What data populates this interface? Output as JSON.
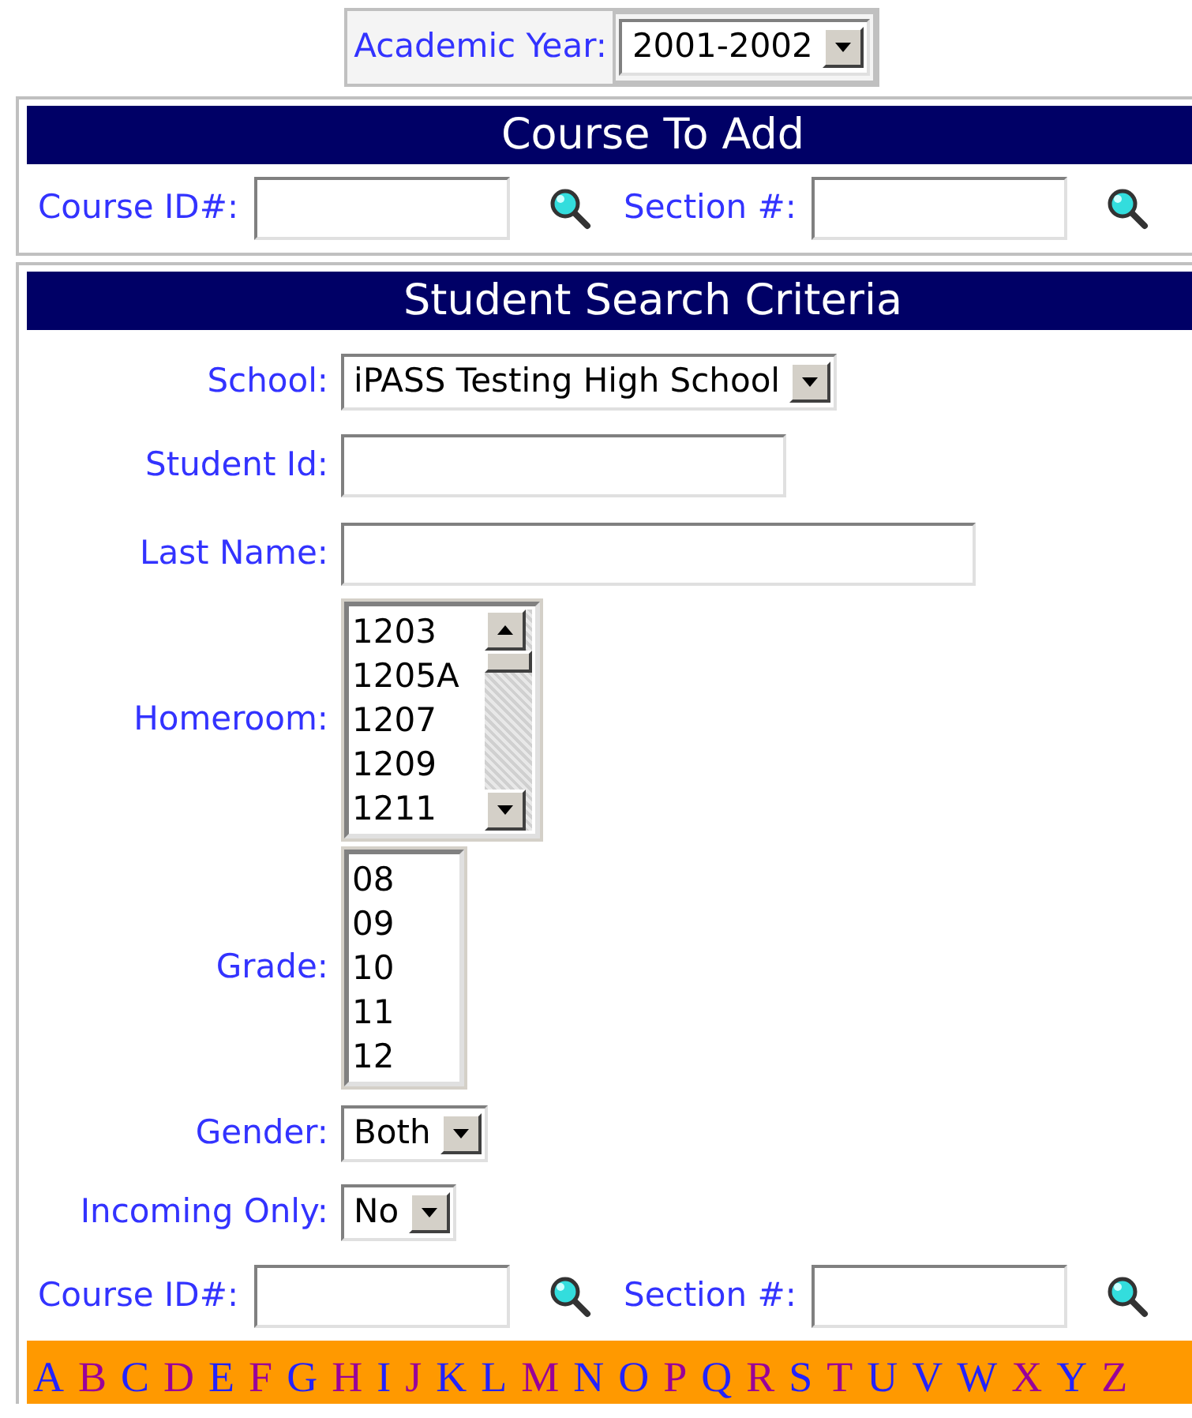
{
  "academic_year": {
    "label": "Academic Year:",
    "value": "2001-2002"
  },
  "course_to_add": {
    "title": "Course To Add",
    "course_label": "Course ID#:",
    "section_label": "Section #:"
  },
  "student_search": {
    "title": "Student Search Criteria",
    "fields": [
      {
        "kind": "select",
        "label": "School:",
        "value": "iPASS Testing High School"
      },
      {
        "kind": "text",
        "label": "Student Id:"
      },
      {
        "kind": "text",
        "label": "Last Name:"
      },
      {
        "kind": "scrolllist",
        "label": "Homeroom:",
        "options": [
          "1203",
          "1205A",
          "1207",
          "1209",
          "1211"
        ]
      },
      {
        "kind": "listbox",
        "label": "Grade:",
        "options": [
          "08",
          "09",
          "10",
          "11",
          "12"
        ]
      },
      {
        "kind": "select",
        "label": "Gender:",
        "value": "Both"
      },
      {
        "kind": "select",
        "label": "Incoming Only:",
        "value": "No"
      }
    ],
    "course_label": "Course ID#:",
    "section_label": "Section #:"
  },
  "letters": [
    {
      "letter": "A",
      "visited": false
    },
    {
      "letter": "B",
      "visited": true
    },
    {
      "letter": "C",
      "visited": false
    },
    {
      "letter": "D",
      "visited": true
    },
    {
      "letter": "E",
      "visited": false
    },
    {
      "letter": "F",
      "visited": true
    },
    {
      "letter": "G",
      "visited": false
    },
    {
      "letter": "H",
      "visited": true
    },
    {
      "letter": "I",
      "visited": false
    },
    {
      "letter": "J",
      "visited": true
    },
    {
      "letter": "K",
      "visited": false
    },
    {
      "letter": "L",
      "visited": false
    },
    {
      "letter": "M",
      "visited": true
    },
    {
      "letter": "N",
      "visited": false
    },
    {
      "letter": "O",
      "visited": false
    },
    {
      "letter": "P",
      "visited": true
    },
    {
      "letter": "Q",
      "visited": false
    },
    {
      "letter": "R",
      "visited": true
    },
    {
      "letter": "S",
      "visited": false
    },
    {
      "letter": "T",
      "visited": true
    },
    {
      "letter": "U",
      "visited": false
    },
    {
      "letter": "V",
      "visited": false
    },
    {
      "letter": "W",
      "visited": false
    },
    {
      "letter": "X",
      "visited": true
    },
    {
      "letter": "Y",
      "visited": false
    },
    {
      "letter": "Z",
      "visited": true
    }
  ]
}
